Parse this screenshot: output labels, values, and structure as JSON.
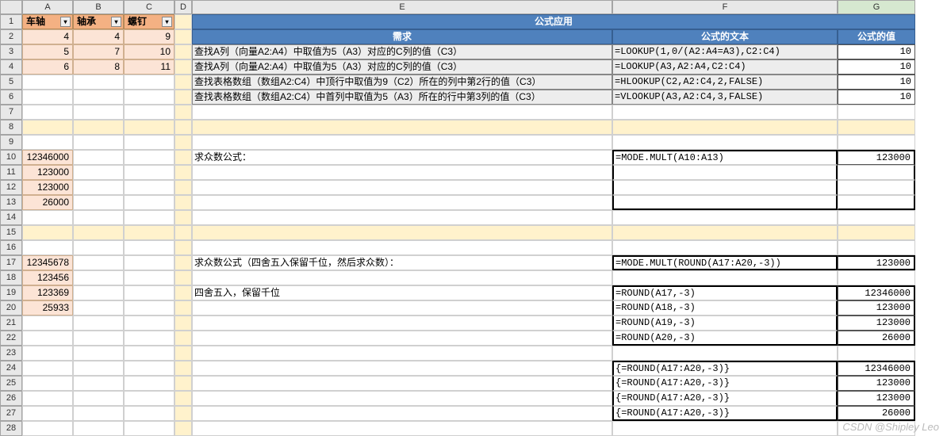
{
  "cols": [
    "A",
    "B",
    "C",
    "D",
    "E",
    "F",
    "G"
  ],
  "table1": {
    "headers": [
      "车轴",
      "轴承",
      "螺钉"
    ],
    "rows": [
      [
        "4",
        "4",
        "9"
      ],
      [
        "5",
        "7",
        "10"
      ],
      [
        "6",
        "8",
        "11"
      ]
    ]
  },
  "appTitle": "公式应用",
  "subHdr": {
    "req": "需求",
    "ftxt": "公式的文本",
    "fval": "公式的值"
  },
  "lookup": [
    {
      "e": "查找A列（向量A2:A4）中取值为5（A3）对应的C列的值（C3）",
      "f": "=LOOKUP(1,0/(A2:A4=A3),C2:C4)",
      "g": "10"
    },
    {
      "e": "查找A列（向量A2:A4）中取值为5（A3）对应的C列的值（C3）",
      "f": "=LOOKUP(A3,A2:A4,C2:C4)",
      "g": "10"
    },
    {
      "e": "查找表格数组（数组A2:C4）中顶行中取值为9（C2）所在的列中第2行的值（C3）",
      "f": "=HLOOKUP(C2,A2:C4,2,FALSE)",
      "g": "10"
    },
    {
      "e": "查找表格数组（数组A2:C4）中首列中取值为5（A3）所在的行中第3列的值（C3）",
      "f": "=VLOOKUP(A3,A2:C4,3,FALSE)",
      "g": "10"
    }
  ],
  "block2": {
    "a": [
      "12346000",
      "123000",
      "123000",
      "26000"
    ],
    "e": "求众数公式：",
    "f": "=MODE.MULT(A10:A13)",
    "g": "123000"
  },
  "block3": {
    "a": [
      "12345678",
      "123456",
      "123369",
      "25933"
    ],
    "e1": "求众数公式（四舍五入保留千位，然后求众数）：",
    "e2": "四舍五入，保留千位",
    "f17": "=MODE.MULT(ROUND(A17:A20,-3))",
    "g17": "123000",
    "rounds": [
      {
        "f": "=ROUND(A17,-3)",
        "g": "12346000"
      },
      {
        "f": "=ROUND(A18,-3)",
        "g": "123000"
      },
      {
        "f": "=ROUND(A19,-3)",
        "g": "123000"
      },
      {
        "f": "=ROUND(A20,-3)",
        "g": "26000"
      }
    ],
    "arr": [
      {
        "f": "{=ROUND(A17:A20,-3)}",
        "g": "12346000"
      },
      {
        "f": "{=ROUND(A17:A20,-3)}",
        "g": "123000"
      },
      {
        "f": "{=ROUND(A17:A20,-3)}",
        "g": "123000"
      },
      {
        "f": "{=ROUND(A17:A20,-3)}",
        "g": "26000"
      }
    ]
  },
  "watermark": "CSDN @Shipley Leo"
}
